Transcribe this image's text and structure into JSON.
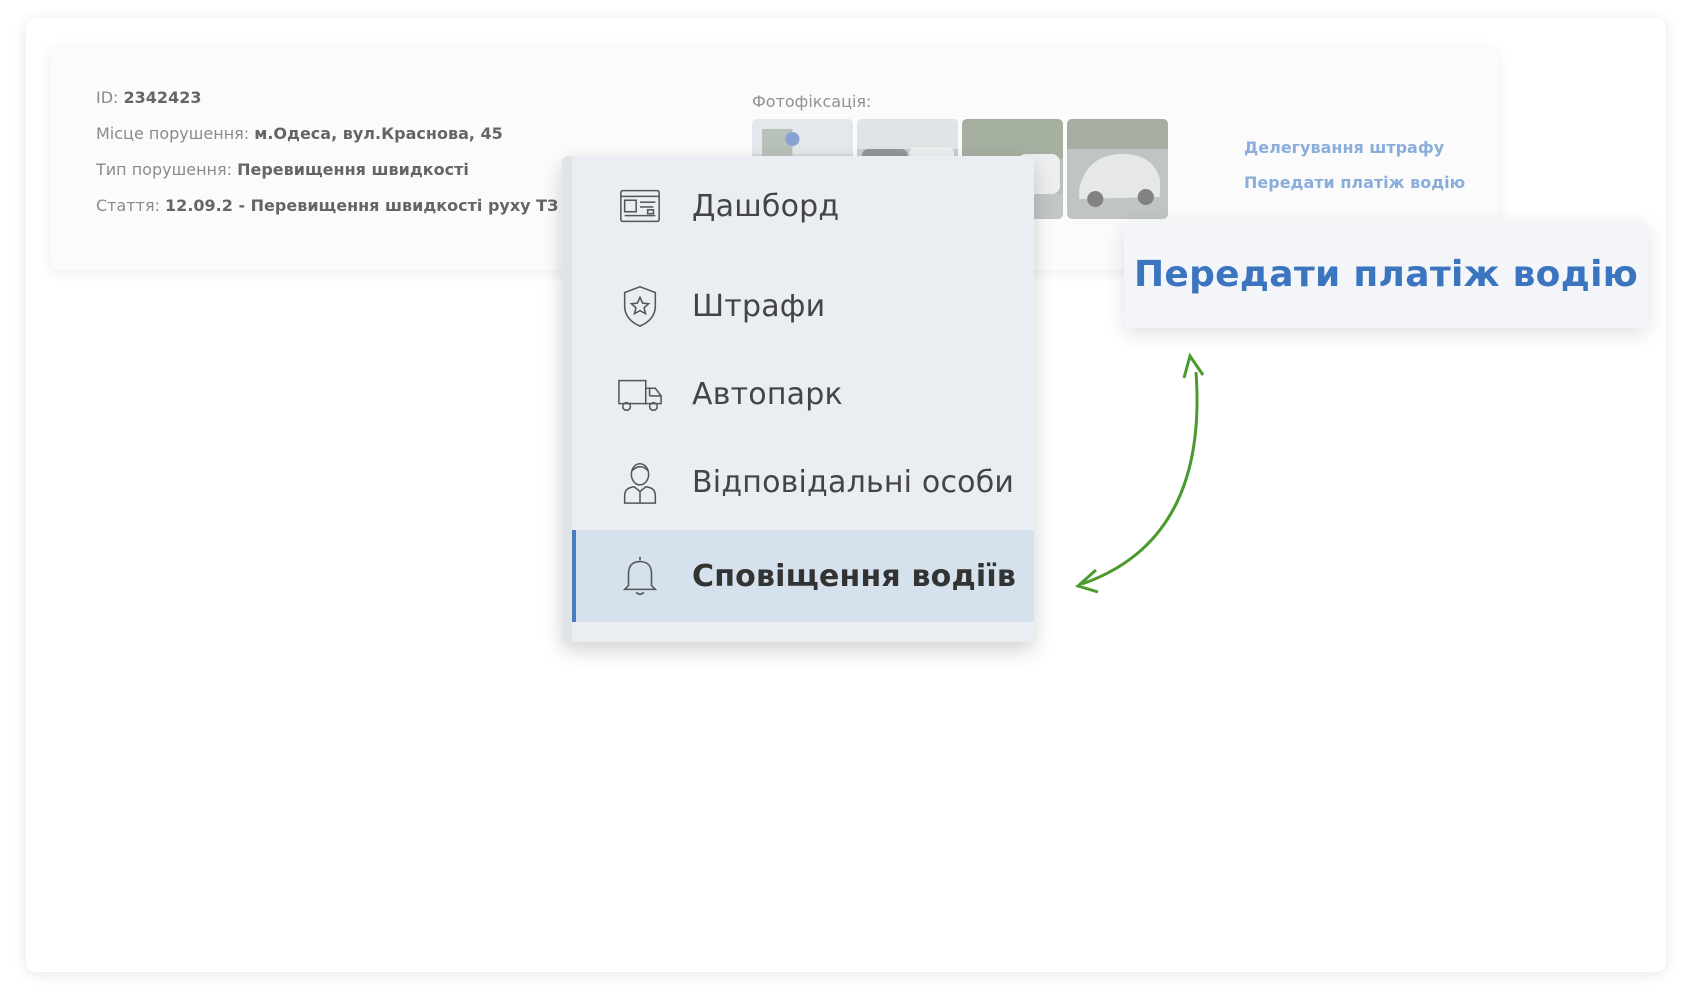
{
  "violation": {
    "id_label": "ID:",
    "id_value": "2342423",
    "place_label": "Місце порушення:",
    "place_value": "м.Одеса, вул.Краснова, 45",
    "type_label": "Тип порушення:",
    "type_value": "Перевищення швидкості",
    "article_label": "Стаття:",
    "article_value": "12.09.2 - Перевищення швидкості руху ТЗ від 20"
  },
  "photos": {
    "label": "Фотофіксація:",
    "count": 4
  },
  "actions": {
    "delegate": "Делегування штрафу",
    "transfer": "Передати платіж водію"
  },
  "menu": {
    "items": [
      {
        "label": "Дашборд",
        "icon": "dashboard-icon"
      },
      {
        "label": "Штрафи",
        "icon": "shield-star-icon"
      },
      {
        "label": "Автопарк",
        "icon": "truck-icon"
      },
      {
        "label": "Відповідальні особи",
        "icon": "person-icon"
      },
      {
        "label": "Сповіщення водіїв",
        "icon": "bell-icon",
        "active": true
      }
    ]
  },
  "tooltip": {
    "text": "Передати платіж водію"
  },
  "colors": {
    "accent": "#3b74bf",
    "link": "#8aaedb",
    "active_bg": "#d5e1ec",
    "arrow": "#4a9a2e"
  }
}
